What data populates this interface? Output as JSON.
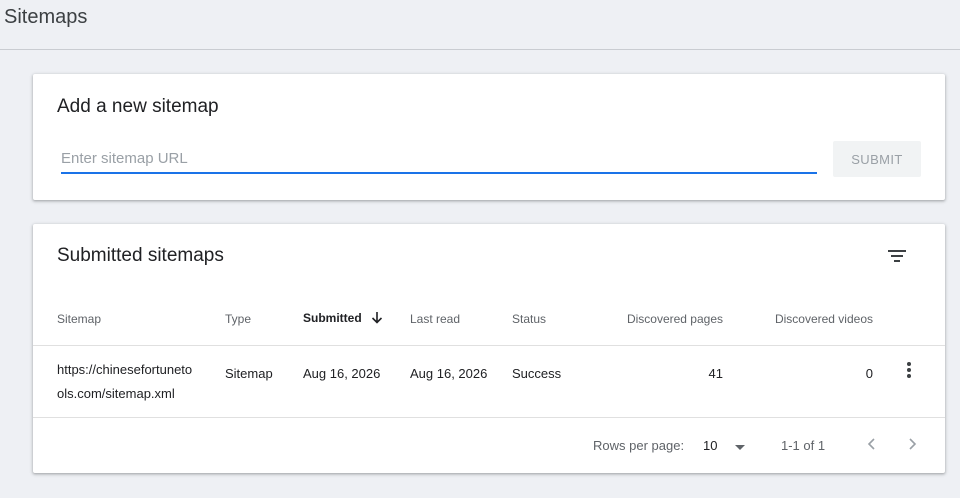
{
  "page": {
    "title": "Sitemaps"
  },
  "add_card": {
    "title": "Add a new sitemap",
    "input_placeholder": "Enter sitemap URL",
    "input_value": "",
    "submit_label": "SUBMIT"
  },
  "list_card": {
    "title": "Submitted sitemaps",
    "columns": {
      "sitemap": "Sitemap",
      "type": "Type",
      "submitted": "Submitted",
      "last_read": "Last read",
      "status": "Status",
      "discovered_pages": "Discovered pages",
      "discovered_videos": "Discovered videos"
    },
    "sort": {
      "column": "submitted",
      "direction": "descending"
    },
    "rows": [
      {
        "sitemap_line1": "https://chinesefortuneto",
        "sitemap_line2": "ols.com/sitemap.xml",
        "type": "Sitemap",
        "submitted": "Aug 16, 2026",
        "last_read": "Aug 16, 2026",
        "status": "Success",
        "discovered_pages": "41",
        "discovered_videos": "0"
      }
    ],
    "footer": {
      "rows_per_page_label": "Rows per page:",
      "rows_per_page_value": "10",
      "range_text": "1-1 of 1"
    }
  },
  "colors": {
    "accent": "#1a73e8",
    "success": "#188038",
    "background": "#eef0f4"
  },
  "icons": [
    "filter-icon",
    "arrow-down-icon",
    "more-vert-icon",
    "dropdown-arrow-icon",
    "chevron-left-icon",
    "chevron-right-icon"
  ]
}
